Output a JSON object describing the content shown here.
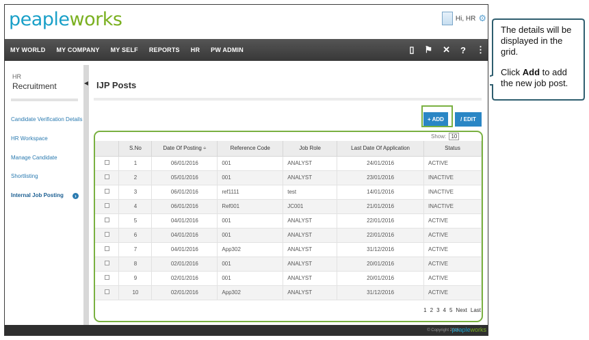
{
  "app": {
    "logo_part1": "peaple",
    "logo_part2": "works"
  },
  "user": {
    "greeting": "Hi, HR"
  },
  "nav": {
    "items": [
      "MY WORLD",
      "MY COMPANY",
      "MY SELF",
      "REPORTS",
      "HR",
      "PW ADMIN"
    ]
  },
  "sidebar": {
    "section": "HR",
    "title": "Recruitment",
    "items": [
      "Candidate Verification Details",
      "HR Workspace",
      "Manage Candidate",
      "Shortlisting",
      "Internal Job Posting"
    ]
  },
  "page": {
    "title": "IJP Posts"
  },
  "toolbar": {
    "add_label": "+ ADD",
    "edit_label": "/ EDIT"
  },
  "grid": {
    "show_label": "Show:",
    "show_value": "10",
    "headers": [
      "S.No",
      "Date Of Posting ÷",
      "Reference Code",
      "Job Role",
      "Last Date Of Application",
      "Status"
    ],
    "rows": [
      [
        "1",
        "06/01/2016",
        "001",
        "ANALYST",
        "24/01/2016",
        "ACTIVE"
      ],
      [
        "2",
        "05/01/2016",
        "001",
        "ANALYST",
        "23/01/2016",
        "INACTIVE"
      ],
      [
        "3",
        "06/01/2016",
        "ref1111",
        "test",
        "14/01/2016",
        "INACTIVE"
      ],
      [
        "4",
        "06/01/2016",
        "Ref001",
        "JC001",
        "21/01/2016",
        "INACTIVE"
      ],
      [
        "5",
        "04/01/2016",
        "001",
        "ANALYST",
        "22/01/2016",
        "ACTIVE"
      ],
      [
        "6",
        "04/01/2016",
        "001",
        "ANALYST",
        "22/01/2016",
        "ACTIVE"
      ],
      [
        "7",
        "04/01/2016",
        "App302",
        "ANALYST",
        "31/12/2016",
        "ACTIVE"
      ],
      [
        "8",
        "02/01/2016",
        "001",
        "ANALYST",
        "20/01/2016",
        "ACTIVE"
      ],
      [
        "9",
        "02/01/2016",
        "001",
        "ANALYST",
        "20/01/2016",
        "ACTIVE"
      ],
      [
        "10",
        "02/01/2016",
        "App302",
        "ANALYST",
        "31/12/2016",
        "ACTIVE"
      ]
    ]
  },
  "pager": {
    "pages": [
      "1",
      "2",
      "3",
      "4",
      "5"
    ],
    "next": "Next",
    "last": "Last"
  },
  "footer": {
    "copyright": "© Copyright 2016",
    "logo_part1": "peaple",
    "logo_part2": "works"
  },
  "callout": {
    "line1": "The details will be displayed in the grid.",
    "line2_pre": "Click ",
    "line2_bold": "Add",
    "line2_post": " to add the new job post."
  },
  "colors": {
    "accent": "#2a86c5",
    "highlight": "#79b040",
    "nav_bg": "#383838",
    "callout_border": "#2e5d6e"
  }
}
